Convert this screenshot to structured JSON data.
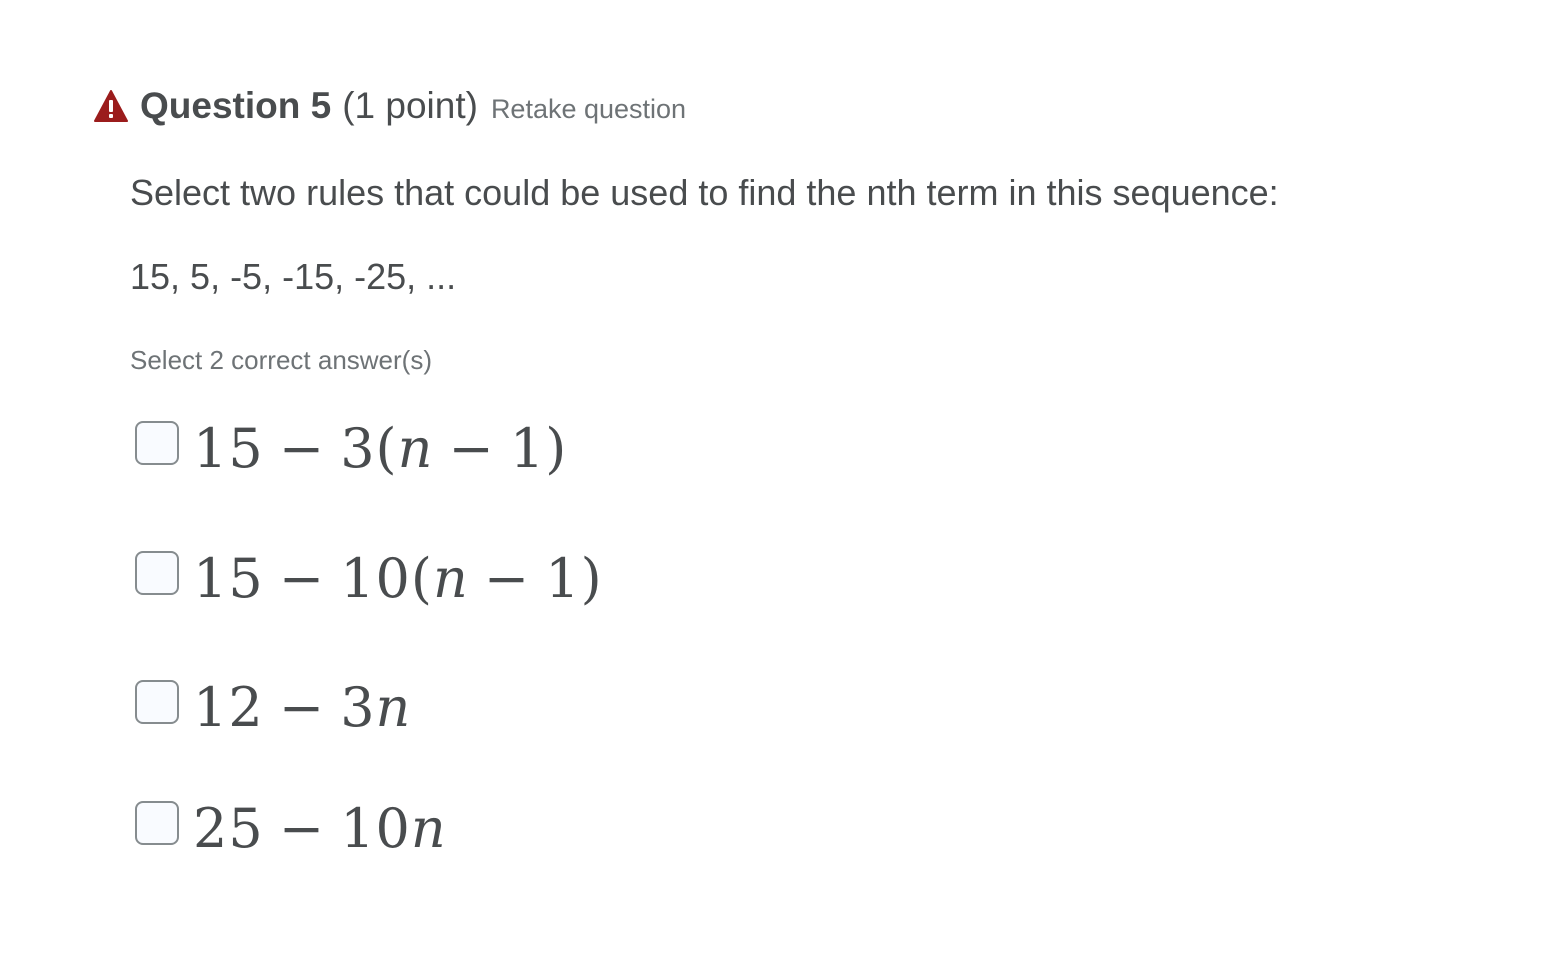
{
  "question": {
    "title": "Question 5",
    "points": "(1 point)",
    "retake_label": "Retake question",
    "status_icon": "warning-triangle-icon",
    "status_color": "#9b1c1c",
    "prompt": "Select two rules that could be used to find the nth term in this sequence:",
    "sequence": "15, 5, -5, -15, -25, ...",
    "instruction": "Select 2 correct answer(s)"
  },
  "options": [
    {
      "parts": [
        "15",
        "−",
        "3(",
        "n",
        "−",
        "1)"
      ],
      "checked": false
    },
    {
      "parts": [
        "15",
        "−",
        "10(",
        "n",
        "−",
        "1)"
      ],
      "checked": false
    },
    {
      "parts": [
        "12",
        "−",
        "3",
        "n"
      ],
      "checked": false
    },
    {
      "parts": [
        "25",
        "−",
        "10",
        "n"
      ],
      "checked": false
    }
  ]
}
